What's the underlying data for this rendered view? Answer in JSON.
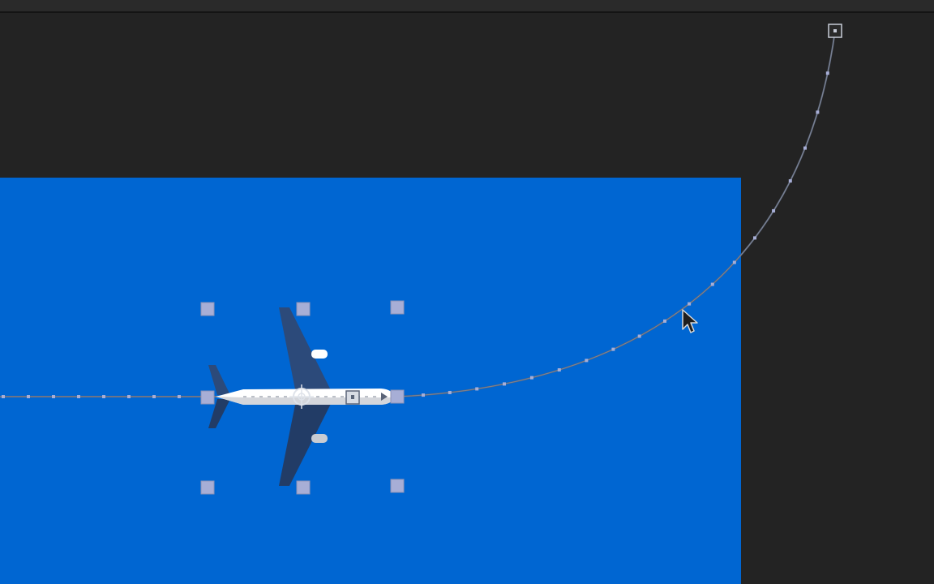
{
  "viewer": {
    "background_color": "#232323",
    "canvas_color": "#0066d2"
  },
  "motion_path": {
    "color": "#7c7f8a",
    "keyframe_color": "#a7aed6",
    "end_keyframe_icon": "keyframe-square-icon"
  },
  "layer": {
    "name": "airplane-layer",
    "icon": "airplane-icon",
    "fuselage_color": "#ffffff",
    "wing_color": "#23406a",
    "anchor_icon": "anchor-point-crosshair-icon"
  },
  "cursor": {
    "icon": "arrow-cursor-icon"
  }
}
